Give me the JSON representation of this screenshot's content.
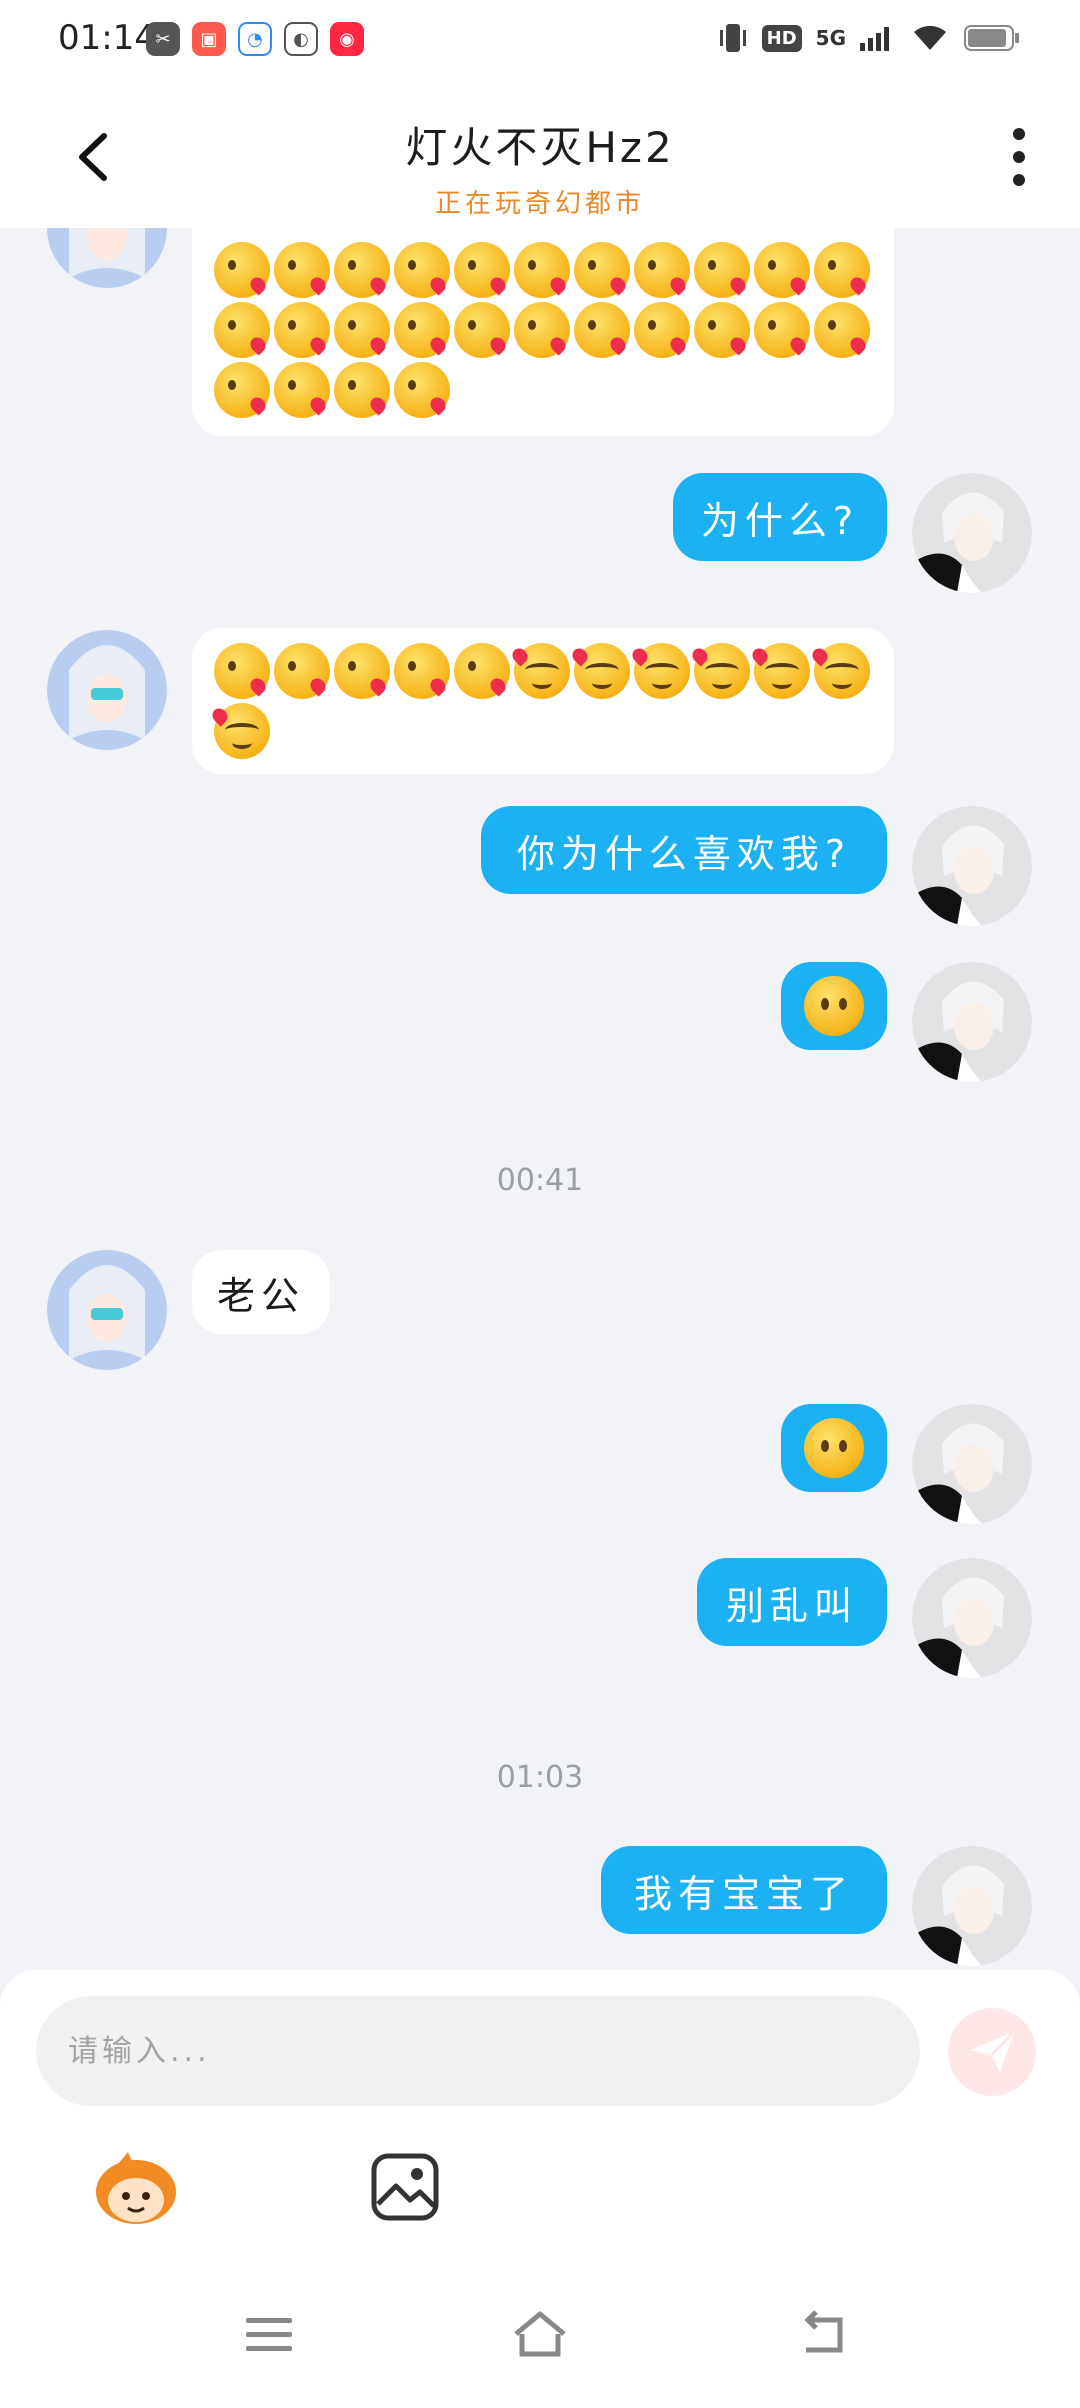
{
  "status_bar": {
    "time": "01:14",
    "network": "5G",
    "hd": "HD"
  },
  "header": {
    "title": "灯火不灭Hz2",
    "subtitle": "正在玩奇幻都市"
  },
  "messages": [
    {
      "side": "in",
      "kind": "emoji",
      "emoji": "face-blowing-a-kiss",
      "count_visible_rows": 3
    },
    {
      "side": "out",
      "kind": "text",
      "text": "为什么?"
    },
    {
      "side": "in",
      "kind": "emoji",
      "emoji": "kiss-and-hearts"
    },
    {
      "side": "out",
      "kind": "text",
      "text": "你为什么喜欢我?"
    },
    {
      "side": "out",
      "kind": "emoji",
      "emoji": "face-without-mouth"
    },
    {
      "timestamp": "00:41"
    },
    {
      "side": "in",
      "kind": "text",
      "text": "老公"
    },
    {
      "side": "out",
      "kind": "emoji",
      "emoji": "face-without-mouth"
    },
    {
      "side": "out",
      "kind": "text",
      "text": "别乱叫"
    },
    {
      "timestamp": "01:03"
    },
    {
      "side": "out",
      "kind": "text",
      "text": "我有宝宝了"
    }
  ],
  "texts": {
    "m1": "为什么?",
    "m2": "你为什么喜欢我?",
    "m3": "老公",
    "m4": "别乱叫",
    "m5": "我有宝宝了",
    "ts1": "00:41",
    "ts2": "01:03"
  },
  "composer": {
    "placeholder": "请输入..."
  },
  "colors": {
    "outgoing_bubble": "#1cb1f2",
    "incoming_bubble": "#ffffff",
    "subtitle": "#e8882a",
    "background": "#f1f3f7"
  },
  "icons": [
    "back-arrow-icon",
    "more-vertical-icon",
    "send-icon",
    "sticker-icon",
    "image-icon",
    "menu-icon",
    "home-icon",
    "back-nav-icon"
  ]
}
